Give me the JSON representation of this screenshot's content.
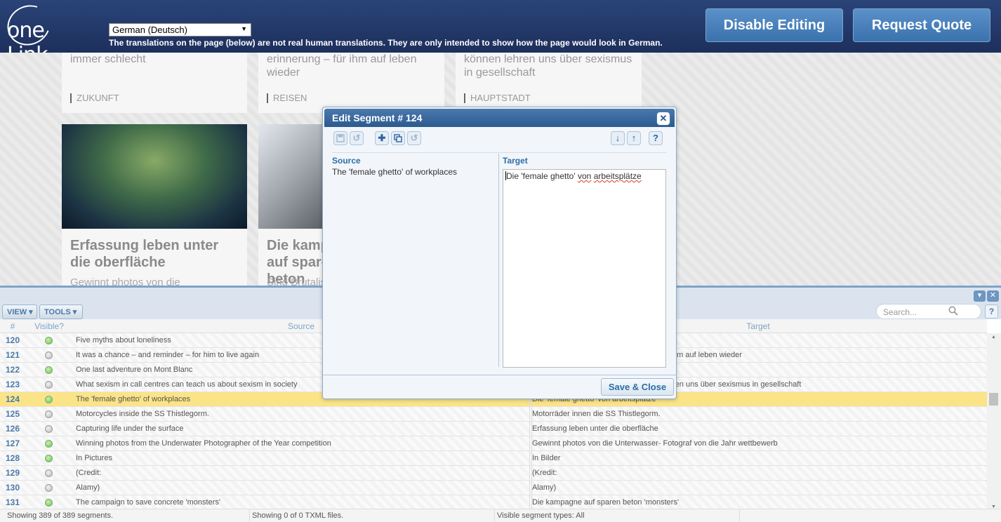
{
  "header": {
    "logo_text": "one Link",
    "language_selected": "German (Deutsch)",
    "disclaimer": "The translations on the page (below) are not real human translations. They are only intended to show how the page would look in German.",
    "disable_editing": "Disable Editing",
    "request_quote": "Request Quote"
  },
  "page": {
    "cards": [
      {
        "snippet": "immer schlecht",
        "tag": "ZUKUNFT"
      },
      {
        "snippet": "erinnerung – für ihm auf leben wieder",
        "tag": "REISEN"
      },
      {
        "snippet": "können lehren uns über sexismus in gesellschaft",
        "tag": "HAUPTSTADT"
      }
    ],
    "articles": [
      {
        "title": "Erfassung leben unter die oberfläche",
        "sub": "Gewinnt photos von die"
      },
      {
        "title": "Die kampagne auf sparen beton",
        "sub": "Sind Brutalismus"
      }
    ]
  },
  "modal": {
    "title": "Edit Segment # 124",
    "close": "✕",
    "source_label": "Source",
    "source_text": "The 'female ghetto' of workplaces",
    "target_label": "Target",
    "target_text_a": "Die 'female ghetto' ",
    "target_text_b": "von",
    "target_text_c": " ",
    "target_text_d": "arbeitsplätze",
    "save_close": "Save & Close"
  },
  "panel": {
    "view": "VIEW",
    "tools": "TOOLS",
    "search_placeholder": "Search...",
    "help": "?",
    "columns": {
      "num": "#",
      "visible": "Visible?",
      "source": "Source",
      "target": "Target"
    },
    "rows": [
      {
        "num": "120",
        "visible": "green",
        "source": "Five myths about loneliness",
        "target": ""
      },
      {
        "num": "121",
        "visible": "grey",
        "source": "It was a chance – and reminder – for him to live again",
        "target": "hm auf leben wieder"
      },
      {
        "num": "122",
        "visible": "green",
        "source": "One last adventure on Mont Blanc",
        "target": ""
      },
      {
        "num": "123",
        "visible": "grey",
        "source": "What sexism in call centres can teach us about sexism in society",
        "target": "ren uns über sexismus in gesellschaft"
      },
      {
        "num": "124",
        "visible": "green",
        "source": "The 'female ghetto' of workplaces",
        "target": "Die 'female ghetto' von arbeitsplätze"
      },
      {
        "num": "125",
        "visible": "grey",
        "source": "Motorcycles inside the SS Thistlegorm.",
        "target": "Motorräder innen die SS Thistlegorm."
      },
      {
        "num": "126",
        "visible": "grey",
        "source": "Capturing life under the surface",
        "target": "Erfassung leben unter die oberfläche"
      },
      {
        "num": "127",
        "visible": "green",
        "source": "Winning photos from the Underwater Photographer of the Year competition",
        "target": "Gewinnt photos von die Unterwasser- Fotograf von die Jahr wettbewerb"
      },
      {
        "num": "128",
        "visible": "green",
        "source": "In Pictures",
        "target": "In Bilder"
      },
      {
        "num": "129",
        "visible": "grey",
        "source": "(Credit:",
        "target": "(Kredit:"
      },
      {
        "num": "130",
        "visible": "grey",
        "source": "Alamy)",
        "target": "Alamy)"
      },
      {
        "num": "131",
        "visible": "green",
        "source": "The campaign to save concrete 'monsters'",
        "target": "Die kampagne auf sparen beton 'monsters'"
      }
    ],
    "status": {
      "segments": "Showing 389 of 389 segments.",
      "files": "Showing 0 of 0 TXML files.",
      "types": "Visible segment types: All"
    }
  }
}
